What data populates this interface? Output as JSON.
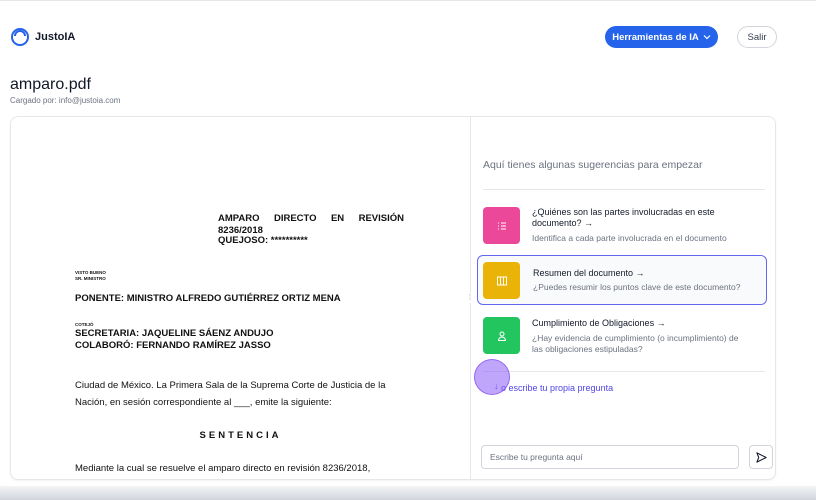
{
  "app": {
    "name": "JustoIA"
  },
  "header": {
    "tools_label": "Herramientas de IA",
    "exit_label": "Salir"
  },
  "file": {
    "name": "amparo.pdf",
    "uploaded_by": "Cargado por: info@justoia.com"
  },
  "document": {
    "caption_words": [
      "AMPARO",
      "DIRECTO",
      "EN",
      "REVISIÓN"
    ],
    "caption_number": "8236/2018",
    "caption_quejoso": "QUEJOSO: **********",
    "visto_bueno": "VISTO BUENO",
    "sr_ministro": "SR. MINISTRO",
    "ponente": "PONENTE: MINISTRO ALFREDO GUTIÉRREZ ORTIZ MENA",
    "cotejo": "COTEJÓ",
    "secretaria": "SECRETARIA: JAQUELINE SÁENZ ANDUJO",
    "colaboro": "COLABORÓ: FERNANDO RAMÍREZ JASSO",
    "para_line1": "Ciudad de México. La Primera Sala de la Suprema Corte de Justicia de la",
    "para_line2": "Nación, en sesión correspondiente al ___, emite la siguiente:",
    "sentencia": "SENTENCIA",
    "final_line": "Mediante la cual se resuelve el amparo directo en revisión 8236/2018,"
  },
  "chat": {
    "intro": "Aquí tienes algunas sugerencias para empezar",
    "suggestions": [
      {
        "title_line1": "¿Quiénes son las partes involucradas en este",
        "title_line2": "documento? →",
        "desc_line1": "Identifica a cada parte involucrada en el documento",
        "color": "#ec4899",
        "icon": "list-icon"
      },
      {
        "title_line1": "Resumen del documento →",
        "desc_line1": "¿Puedes resumir los puntos clave de este documento?",
        "color": "#eab308",
        "icon": "columns-icon"
      },
      {
        "title_line1": "Cumplimiento de Obligaciones →",
        "desc_line1": "¿Hay evidencia de cumplimiento (o incumplimiento) de",
        "desc_line2": "las obligaciones estipuladas?",
        "color": "#22c55e",
        "icon": "user-icon"
      }
    ],
    "own_question": "o escribe tu propia pregunta",
    "input_placeholder": "Escribe tu pregunta aquí"
  },
  "colors": {
    "accent": "#2563eb",
    "active_border": "#6366f1"
  }
}
